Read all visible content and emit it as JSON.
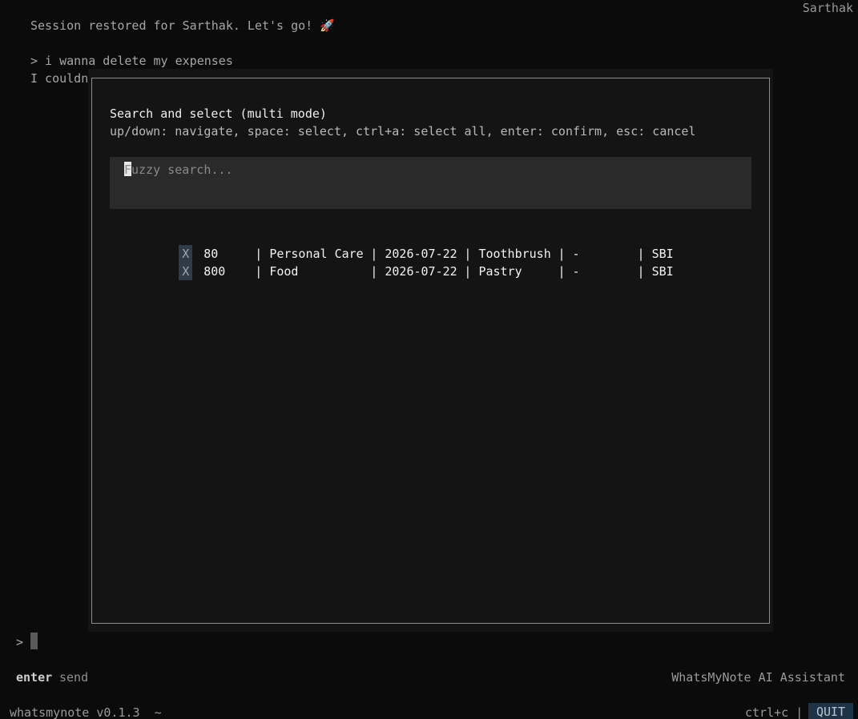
{
  "header": {
    "user": "Sarthak"
  },
  "chat": {
    "session_message": "Session restored for Sarthak. Let's go! 🚀",
    "user_message": "> i wanna delete my expenses",
    "assistant_partial": "I couldn"
  },
  "modal": {
    "title": "Search and select (multi mode)",
    "help": "up/down: navigate, space: select, ctrl+a: select all, enter: confirm, esc: cancel",
    "search": {
      "placeholder": "Fuzzy search...",
      "value": ""
    },
    "rows": [
      {
        "mark": "X",
        "amount": "80",
        "category": "Personal Care",
        "date": "2026-07-22",
        "item": "Toothbrush",
        "note": "-",
        "account": "SBI"
      },
      {
        "mark": "X",
        "amount": "800",
        "category": "Food",
        "date": "2026-07-22",
        "item": "Pastry",
        "note": "-",
        "account": "SBI"
      }
    ]
  },
  "input": {
    "prompt": ">"
  },
  "footer": {
    "enter_key": "enter",
    "enter_action": "send",
    "assistant_name": "WhatsMyNote AI Assistant",
    "version": "whatsmynote v0.1.3  ~",
    "quit_hint": "ctrl+c |",
    "quit_label": "QUIT"
  },
  "colors": {
    "background": "#0b0b0b",
    "modal_bg": "#141414",
    "search_bg": "#2a2a2a",
    "mark_bg": "#2f3b47",
    "quit_bg": "#1f3347"
  }
}
